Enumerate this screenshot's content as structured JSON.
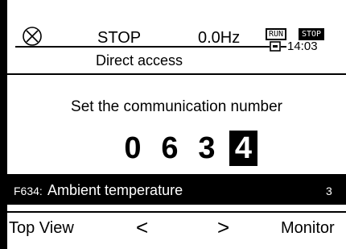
{
  "status": {
    "state": "STOP",
    "frequency": "0.0Hz",
    "mode_run": "RUN",
    "mode_stop": "STOP",
    "time": "14:03"
  },
  "title": "Direct access",
  "prompt": "Set the communication number",
  "digits": [
    "0",
    "6",
    "3",
    "4"
  ],
  "selected_digit_index": 3,
  "parameter": {
    "code": "F634:",
    "name": "Ambient temperature",
    "value": "3"
  },
  "softkeys": {
    "left": "Top View",
    "prev": "<",
    "next": ">",
    "right": "Monitor"
  },
  "icons": {
    "status_icon": "circle-x-icon",
    "card_icon": "memory-card-icon"
  }
}
